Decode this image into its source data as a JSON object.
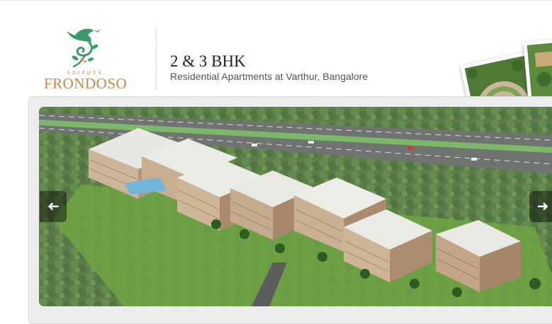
{
  "brand": {
    "name_small": "ADITHYA",
    "name_large": "FRONDOSO",
    "colors": {
      "green": "#3a9a6e",
      "gold": "#c28a4a"
    }
  },
  "header": {
    "headline": "2 & 3 BHK",
    "subheadline": "Residential Apartments at Varthur, Bangalore"
  },
  "slider": {
    "prev_icon": "arrow-left-icon",
    "next_icon": "arrow-right-icon",
    "prev_glyph": "➜",
    "next_glyph": "➜"
  }
}
